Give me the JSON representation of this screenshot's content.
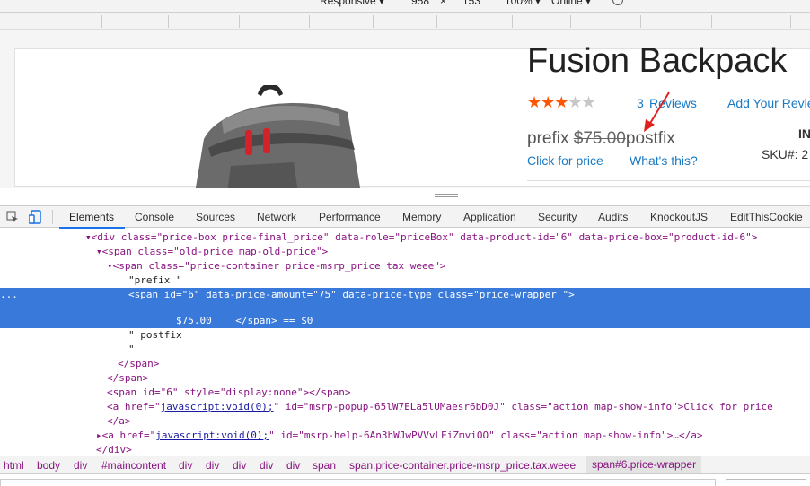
{
  "devbar": {
    "device": "Responsive ▾",
    "width": "958",
    "times": "×",
    "height": "153",
    "zoom": "100% ▾",
    "network": "Online ▾"
  },
  "product": {
    "title": "Fusion Backpack",
    "stars": "★★★",
    "stars_off": "★★",
    "reviews_count": "3",
    "reviews_label": "Reviews",
    "add_review": "Add Your Revie",
    "price_prefix": "prefix",
    "price_old": "$75.00",
    "price_postfix": "postfix",
    "click_for_price": "Click for price",
    "whats_this": "What's this?",
    "stock": "IN",
    "sku": "SKU#:  2"
  },
  "tabs": [
    "Elements",
    "Console",
    "Sources",
    "Network",
    "Performance",
    "Memory",
    "Application",
    "Security",
    "Audits",
    "KnockoutJS",
    "EditThisCookie"
  ],
  "dom": {
    "l1": "▾<div class=\"price-box price-final_price\" data-role=\"priceBox\" data-product-id=\"6\" data-price-box=\"product-id-6\">",
    "l2": "▾<span class=\"old-price map-old-price\">",
    "l3": "▾<span class=\"price-container price-msrp_price tax weee\">",
    "l4": "\"prefix \"",
    "l5": "<span id=\"6\" data-price-amount=\"75\" data-price-type class=\"price-wrapper \">",
    "l6": "$75.00    </span> == $0",
    "l7": "\" postfix",
    "l8": "\"",
    "l9": "</span>",
    "l10": "</span>",
    "l11": "<span id=\"6\" style=\"display:none\"></span>",
    "l12a": "<a href=\"",
    "l12b": "javascript:void(0);",
    "l12c": "\" id=\"msrp-popup-65lW7ELa5lUMaesr6bD0J\" class=\"action map-show-info\">Click for price",
    "l13": "</a>",
    "l14a": "▸<a href=\"",
    "l14b": "javascript:void(0);",
    "l14c": "\" id=\"msrp-help-6An3hWJwPVVvLEiZmviOO\" class=\"action map-show-info\">…</a>",
    "l15": "</div>",
    "dots": "..."
  },
  "crumbs": [
    "html",
    "body",
    "div",
    "#maincontent",
    "div",
    "div",
    "div",
    "div",
    "div",
    "span",
    "span.price-container.price-msrp_price.tax.weee",
    "span#6.price-wrapper"
  ]
}
